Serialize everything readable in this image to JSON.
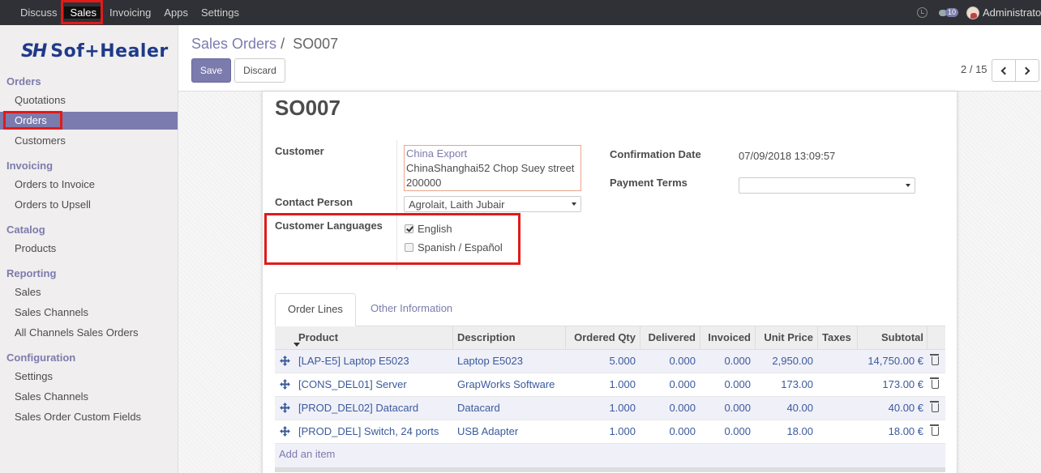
{
  "topnav": {
    "items": [
      "Discuss",
      "Sales",
      "Invoicing",
      "Apps",
      "Settings"
    ],
    "active": "Sales",
    "chat_count": "10",
    "user": "Administrator"
  },
  "sidebar": {
    "logo_mark": "SH",
    "logo_text": "Sof+Healer",
    "sections": [
      {
        "title": "Orders",
        "items": [
          "Quotations",
          "Orders",
          "Customers"
        ]
      },
      {
        "title": "Invoicing",
        "items": [
          "Orders to Invoice",
          "Orders to Upsell"
        ]
      },
      {
        "title": "Catalog",
        "items": [
          "Products"
        ]
      },
      {
        "title": "Reporting",
        "items": [
          "Sales",
          "Sales Channels",
          "All Channels Sales Orders"
        ]
      },
      {
        "title": "Configuration",
        "items": [
          "Settings",
          "Sales Channels",
          "Sales Order Custom Fields"
        ]
      }
    ],
    "active_item": "Orders"
  },
  "control_panel": {
    "breadcrumb_parent": "Sales Orders",
    "breadcrumb_sep": "/",
    "breadcrumb_current": "SO007",
    "save_label": "Save",
    "discard_label": "Discard",
    "pager": "2 / 15"
  },
  "form": {
    "title": "SO007",
    "customer_label": "Customer",
    "customer_name": "China Export",
    "customer_address_1": "ChinaShanghai52 Chop Suey street",
    "customer_address_2": "200000",
    "contact_label": "Contact Person",
    "contact_value": "Agrolait, Laith Jubair",
    "languages_label": "Customer Languages",
    "languages": [
      {
        "label": "English",
        "checked": true
      },
      {
        "label": "Spanish / Español",
        "checked": false
      }
    ],
    "confirmation_label": "Confirmation Date",
    "confirmation_value": "07/09/2018 13:09:57",
    "payment_terms_label": "Payment Terms",
    "payment_terms_value": ""
  },
  "tabs": [
    "Order Lines",
    "Other Information"
  ],
  "table": {
    "columns": [
      "Product",
      "Description",
      "Ordered Qty",
      "Delivered",
      "Invoiced",
      "Unit Price",
      "Taxes",
      "Subtotal"
    ],
    "rows": [
      [
        "[LAP-E5] Laptop E5023",
        "Laptop E5023",
        "5.000",
        "0.000",
        "0.000",
        "2,950.00",
        "",
        "14,750.00 €"
      ],
      [
        "[CONS_DEL01] Server",
        "GrapWorks Software",
        "1.000",
        "0.000",
        "0.000",
        "173.00",
        "",
        "173.00 €"
      ],
      [
        "[PROD_DEL02] Datacard",
        "Datacard",
        "1.000",
        "0.000",
        "0.000",
        "40.00",
        "",
        "40.00 €"
      ],
      [
        "[PROD_DEL] Switch, 24 ports",
        "USB Adapter",
        "1.000",
        "0.000",
        "0.000",
        "18.00",
        "",
        "18.00 €"
      ]
    ],
    "add_item": "Add an item"
  },
  "colors": {
    "accent": "#7c7bad",
    "highlight": "#e01b1b",
    "topbar": "#2f3136"
  }
}
